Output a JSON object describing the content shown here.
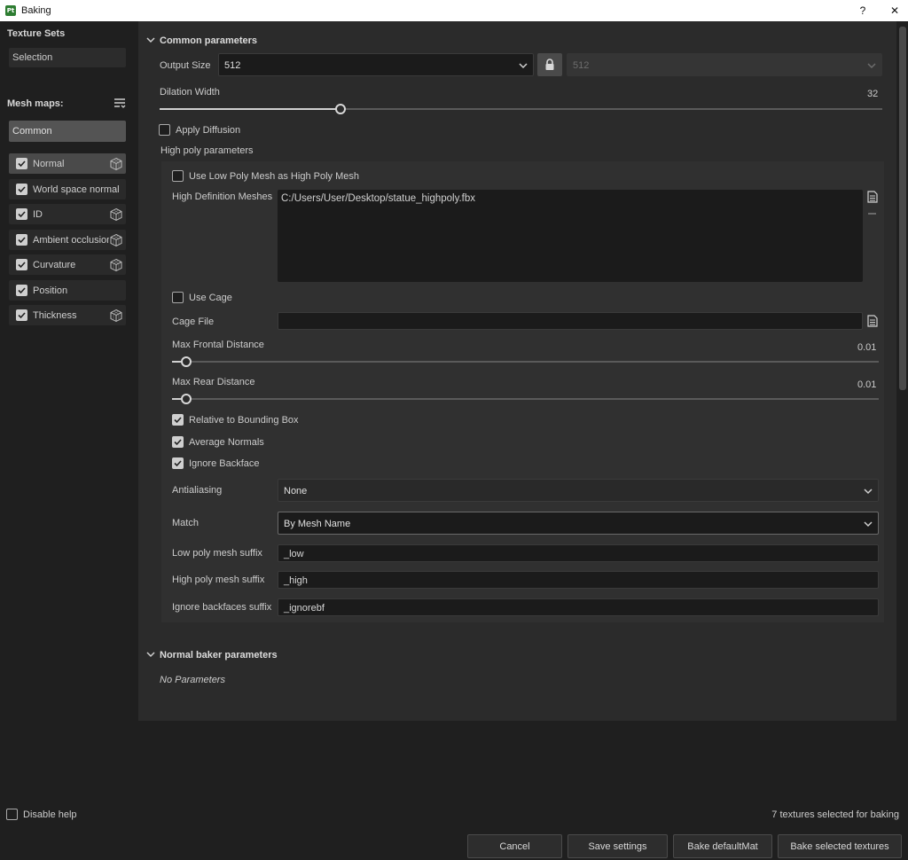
{
  "window": {
    "title": "Baking",
    "app_icon_text": "Pt",
    "help_label": "?",
    "close_label": "✕"
  },
  "left": {
    "texture_sets_title": "Texture Sets",
    "selection_label": "Selection",
    "mesh_maps_title": "Mesh maps:",
    "common_label": "Common",
    "maps": [
      {
        "label": "Normal",
        "checked": true,
        "has_cube": true
      },
      {
        "label": "World space normal",
        "checked": true,
        "has_cube": false
      },
      {
        "label": "ID",
        "checked": true,
        "has_cube": true
      },
      {
        "label": "Ambient occlusion",
        "checked": true,
        "has_cube": true
      },
      {
        "label": "Curvature",
        "checked": true,
        "has_cube": true
      },
      {
        "label": "Position",
        "checked": true,
        "has_cube": false
      },
      {
        "label": "Thickness",
        "checked": true,
        "has_cube": true
      }
    ],
    "disable_help_label": "Disable help"
  },
  "common": {
    "header": "Common parameters",
    "output_size_label": "Output Size",
    "output_size_value": "512",
    "output_size_locked_value": "512",
    "dilation_label": "Dilation Width",
    "dilation_value": "32",
    "dilation_fraction": 0.25,
    "apply_diffusion_label": "Apply Diffusion",
    "high_poly_header": "High poly parameters",
    "use_low_poly_label": "Use Low Poly Mesh as High Poly Mesh",
    "high_def_meshes_label": "High Definition Meshes",
    "high_def_meshes_value": "C:/Users/User/Desktop/statue_highpoly.fbx",
    "use_cage_label": "Use Cage",
    "cage_file_label": "Cage File",
    "cage_file_value": "",
    "max_frontal_label": "Max Frontal Distance",
    "max_frontal_value": "0.01",
    "max_rear_label": "Max Rear Distance",
    "max_rear_value": "0.01",
    "relative_bbox_label": "Relative to Bounding Box",
    "average_normals_label": "Average Normals",
    "ignore_backface_label": "Ignore Backface",
    "antialiasing_label": "Antialiasing",
    "antialiasing_value": "None",
    "match_label": "Match",
    "match_value": "By Mesh Name",
    "low_suffix_label": "Low poly mesh suffix",
    "low_suffix_value": "_low",
    "high_suffix_label": "High poly mesh suffix",
    "high_suffix_value": "_high",
    "ignore_suffix_label": "Ignore backfaces suffix",
    "ignore_suffix_value": "_ignorebf"
  },
  "normal_baker": {
    "header": "Normal baker parameters",
    "no_params": "No Parameters"
  },
  "footer": {
    "status": "7 textures selected for baking",
    "cancel": "Cancel",
    "save_settings": "Save settings",
    "bake_default": "Bake defaultMat",
    "bake_selected": "Bake selected textures"
  }
}
